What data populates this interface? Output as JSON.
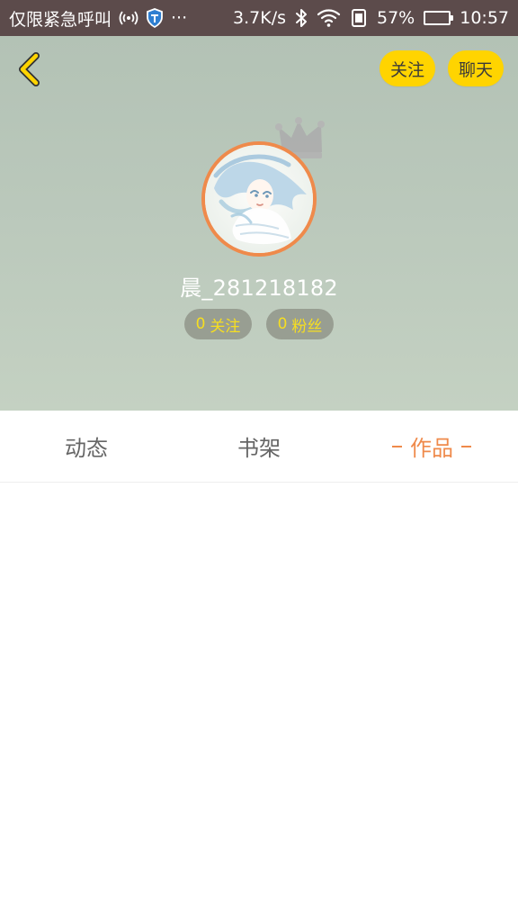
{
  "status_bar": {
    "carrier": "仅限紧急呼叫",
    "more": "···",
    "network_speed": "3.7K/s",
    "battery_percent": "57%",
    "battery_level": 0.57,
    "time": "10:57"
  },
  "header_actions": {
    "follow_label": "关注",
    "chat_label": "聊天"
  },
  "profile": {
    "username": "晨_281218182",
    "following_count": "0",
    "following_label": "关注",
    "fans_count": "0",
    "fans_label": "粉丝"
  },
  "tabs": [
    {
      "label": "动态",
      "active": false
    },
    {
      "label": "书架",
      "active": false
    },
    {
      "label": "作品",
      "active": true
    }
  ],
  "colors": {
    "status_bar": "#5c4b4b",
    "header_background": "#bac8bb",
    "accent_yellow": "#ffd400",
    "active_orange": "#ef8a4b",
    "stat_text_yellow": "#f6de21"
  },
  "icons": [
    "signal-antenna-icon",
    "shield-icon",
    "bluetooth-icon",
    "wifi-icon",
    "sim-icon",
    "battery-icon",
    "back-arrow-icon",
    "crown-icon"
  ]
}
